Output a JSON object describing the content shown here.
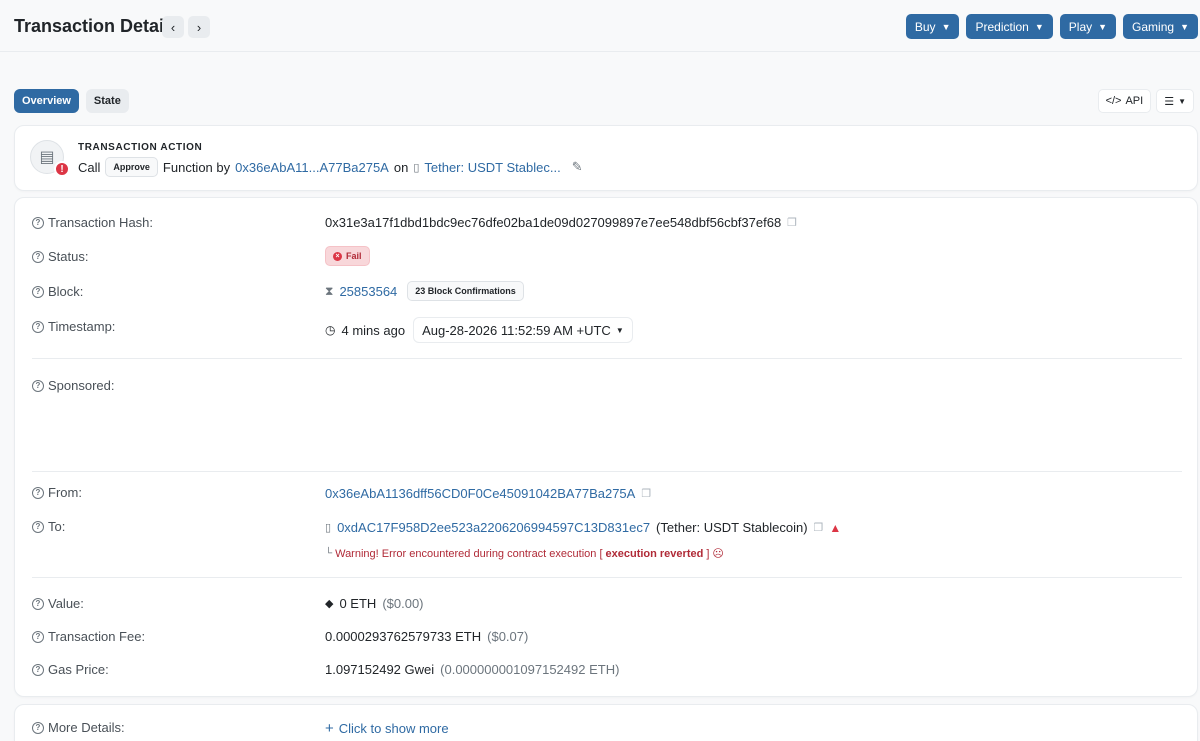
{
  "header": {
    "title": "Transaction Details",
    "prev_label": "‹",
    "next_label": "›",
    "buttons": [
      {
        "label": "Buy"
      },
      {
        "label": "Prediction"
      },
      {
        "label": "Play"
      },
      {
        "label": "Gaming"
      }
    ]
  },
  "tabs": [
    {
      "label": "Overview",
      "active": true
    },
    {
      "label": "State",
      "active": false
    }
  ],
  "tools": {
    "api_label": "API"
  },
  "action": {
    "heading": "TRANSACTION ACTION",
    "call": "Call",
    "method": "Approve",
    "function_by": "Function by",
    "from_short": "0x36eAbA11...A77Ba275A",
    "on": "on",
    "contract": "Tether: USDT Stablec..."
  },
  "details": {
    "hash_label": "Transaction Hash:",
    "hash": "0x31e3a17f1dbd1bdc9ec76dfe02ba1de09d027099897e7ee548dbf56cbf37ef68",
    "status_label": "Status:",
    "status": "Fail",
    "block_label": "Block:",
    "block": "25853564",
    "confirmations": "23 Block Confirmations",
    "timestamp_label": "Timestamp:",
    "age": "4 mins ago",
    "timestamp": "Aug-28-2026 11:52:59 AM +UTC",
    "sponsored_label": "Sponsored:",
    "from_label": "From:",
    "from": "0x36eAbA1136dff56CD0F0Ce45091042BA77Ba275A",
    "to_label": "To:",
    "to": "0xdAC17F958D2ee523a2206206994597C13D831ec7",
    "to_name": "(Tether: USDT Stablecoin)",
    "warning_prefix": "Warning! Error encountered during contract execution [",
    "warning_bold": "execution reverted",
    "warning_suffix": "]",
    "value_label": "Value:",
    "value": "0 ETH",
    "value_usd": "($0.00)",
    "fee_label": "Transaction Fee:",
    "fee": "0.0000293762579733 ETH",
    "fee_usd": "($0.07)",
    "gas_label": "Gas Price:",
    "gas": "1.097152492 Gwei",
    "gas_eth": "(0.000000001097152492 ETH)"
  },
  "more": {
    "label": "More Details:",
    "button": "Click to show more"
  },
  "colors": {
    "accent": "#2f6aa3",
    "error": "#dc3545"
  }
}
